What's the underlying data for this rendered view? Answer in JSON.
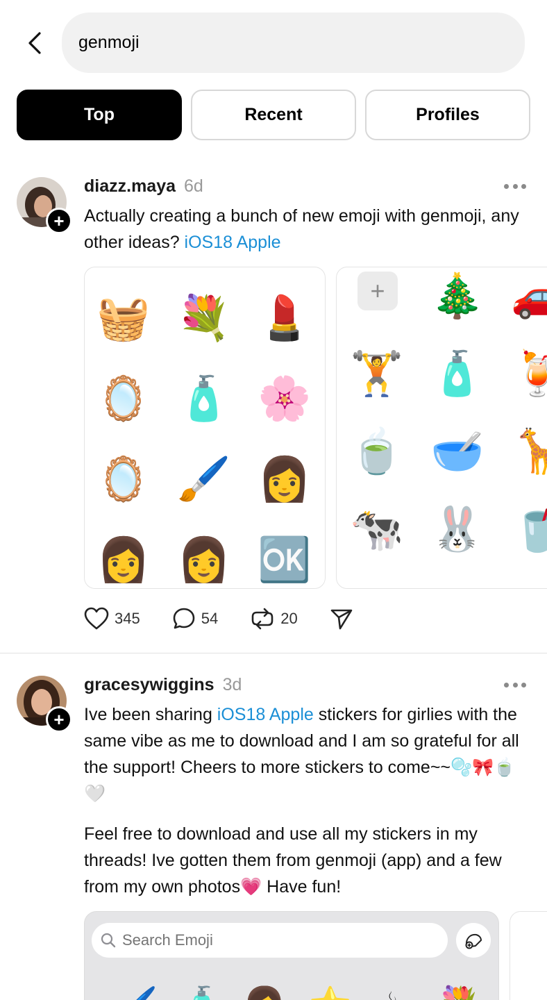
{
  "search": {
    "query": "genmoji"
  },
  "tabs": [
    {
      "label": "Top",
      "active": true
    },
    {
      "label": "Recent",
      "active": false
    },
    {
      "label": "Profiles",
      "active": false
    }
  ],
  "posts": [
    {
      "username": "diazz.maya",
      "time": "6d",
      "text_before": "Actually creating a bunch of new emoji with genmoji, any other ideas? ",
      "tag": "iOS18 Apple",
      "media_left_emojis": [
        "🧺",
        "💐",
        "💄",
        "🪞",
        "🧴",
        "🌸",
        "🪞",
        "🖌️",
        "👩",
        "👩",
        "👩",
        "🆗"
      ],
      "media_right_emojis": [
        "🎄",
        "🚗",
        "🏋️",
        "🧴",
        "🍹",
        "🍵",
        "🥣",
        "🦒",
        "🐄",
        "🐰",
        "🥤"
      ],
      "likes": "345",
      "comments": "54",
      "reposts": "20"
    },
    {
      "username": "gracesywiggins",
      "time": "3d",
      "para1_before": "Ive been sharing ",
      "tag": "iOS18 Apple",
      "para1_after": " stickers for girlies with the same vibe as me to download and I am so grateful for all the support! Cheers to more stickers to come~~🫧🎀🍵🤍",
      "para2": "Feel free to download and use all my stickers in my threads! Ive gotten them from genmoji (app) and a few from my own photos💗 Have fun!",
      "emoji_search_placeholder": "Search Emoji",
      "kbd_emojis": [
        "🖌️",
        "🧴",
        "👩",
        "⭐",
        "☕",
        "💐"
      ]
    }
  ],
  "colors": {
    "link": "#1b8fd6",
    "tab_active_bg": "#000000"
  }
}
